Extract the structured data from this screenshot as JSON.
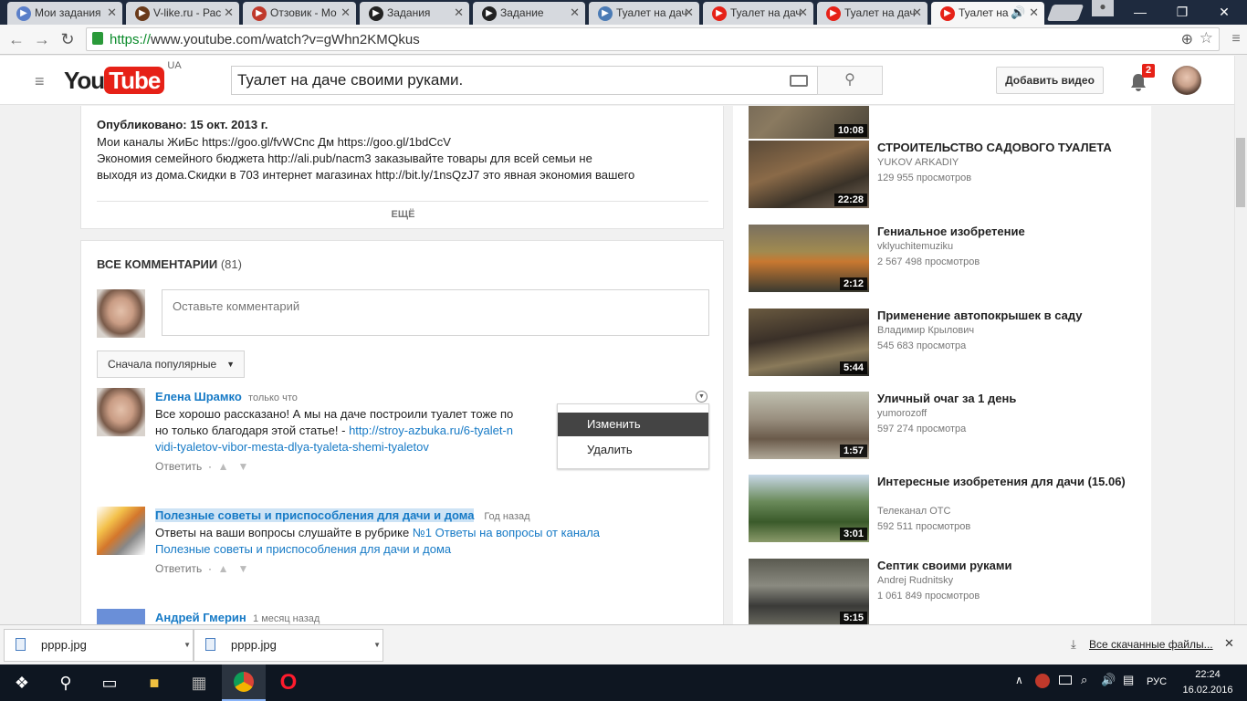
{
  "tabs": [
    {
      "label": "Мои задания",
      "icon": "spiral-icon",
      "color": "#5a7fc9"
    },
    {
      "label": "V-like.ru - Рас",
      "icon": "v-logo-icon",
      "color": "#6a3a1a"
    },
    {
      "label": "Отзовик - Мо",
      "icon": "otzovik-icon",
      "color": "#c0392b"
    },
    {
      "label": "Задания",
      "icon": "github-icon",
      "color": "#222"
    },
    {
      "label": "Задание",
      "icon": "github-icon",
      "color": "#222"
    },
    {
      "label": "Туалет на дач",
      "icon": "house-icon",
      "color": "#4b7bb5"
    },
    {
      "label": "Туалет на дач",
      "icon": "youtube-icon",
      "color": "#e62117"
    },
    {
      "label": "Туалет на дач",
      "icon": "youtube-icon",
      "color": "#e62117"
    },
    {
      "label": "Туалет на",
      "icon": "youtube-icon",
      "color": "#e62117"
    }
  ],
  "address": {
    "scheme": "https://",
    "rest": "www.youtube.com/watch?v=gWhn2KMQkus"
  },
  "header": {
    "logo_you": "You",
    "logo_tube": "Tube",
    "logo_region": "UA",
    "search_value": "Туалет на даче своими руками.",
    "upload_label": "Добавить видео",
    "notif_count": "2"
  },
  "description": {
    "published": "Опубликовано: 15 окт. 2013 г.",
    "line1": "Мои каналы ЖиБс https://goo.gl/fvWCnc Дм https://goo.gl/1bdCcV",
    "line2": "Экономия семейного бюджета http://ali.pub/nacm3 заказывайте товары для всей семьи не",
    "line3": "выходя из дома.Скидки в 703 интернет магазинах http://bit.ly/1nsQzJ7 это явная экономия вашего",
    "more": "ЕЩЁ"
  },
  "comments": {
    "header": "ВСЕ КОММЕНТАРИИ",
    "count": "(81)",
    "placeholder": "Оставьте комментарий",
    "sort_label": "Сначала популярные",
    "reply_label": "Ответить",
    "items": [
      {
        "author": "Елена Шрамко",
        "time": "только что",
        "text1": "Все хорошо рассказано! А мы на даче построили туалет тоже по",
        "text2": "но только благодаря этой статье! - ",
        "link1": "http://stroy-azbuka.ru/6-tyalet-n",
        "link2": "vidi-tyaletov-vibor-mesta-dlya-tyaleta-shemi-tyaletov"
      },
      {
        "author": "Полезные советы и приспособления для дачи и дома",
        "time": "Год назад",
        "text1": "Ответы на ваши вопросы слушайте в рубрике ",
        "link1": "№1 Ответы на вопросы от канала",
        "link2": "Полезные советы и приспособления для дачи и дома"
      },
      {
        "author": "Андрей Гмерин",
        "time": "1 месяц назад"
      }
    ],
    "menu": [
      "Изменить",
      "Удалить"
    ]
  },
  "related": [
    {
      "duration": "10:08"
    },
    {
      "title": "СТРОИТЕЛЬСТВО САДОВОГО ТУАЛЕТА",
      "channel": "YUKOV ARKADIY",
      "views": "129 955 просмотров",
      "duration": "22:28"
    },
    {
      "title": "Гениальное изобретение",
      "channel": "vklyuchitemuziku",
      "views": "2 567 498 просмотров",
      "duration": "2:12"
    },
    {
      "title": "Применение автопокрышек в саду",
      "channel": "Владимир Крылович",
      "views": "545 683 просмотра",
      "duration": "5:44"
    },
    {
      "title": "Уличный очаг за 1 день",
      "channel": "yumorozoff",
      "views": "597 274 просмотра",
      "duration": "1:57"
    },
    {
      "title": "Интересные изобретения для дачи (15.06)",
      "channel": "Телеканал ОТС",
      "views": "592 511 просмотров",
      "duration": "3:01"
    },
    {
      "title": "Септик своими руками",
      "channel": "Andrej Rudnitsky",
      "views": "1 061 849 просмотров",
      "duration": "5:15"
    }
  ],
  "downloads": {
    "items": [
      "pppp.jpg",
      "pppp.jpg"
    ],
    "all_label": "Все скачанные файлы..."
  },
  "taskbar": {
    "lang": "РУС",
    "time": "22:24",
    "date": "16.02.2016"
  }
}
